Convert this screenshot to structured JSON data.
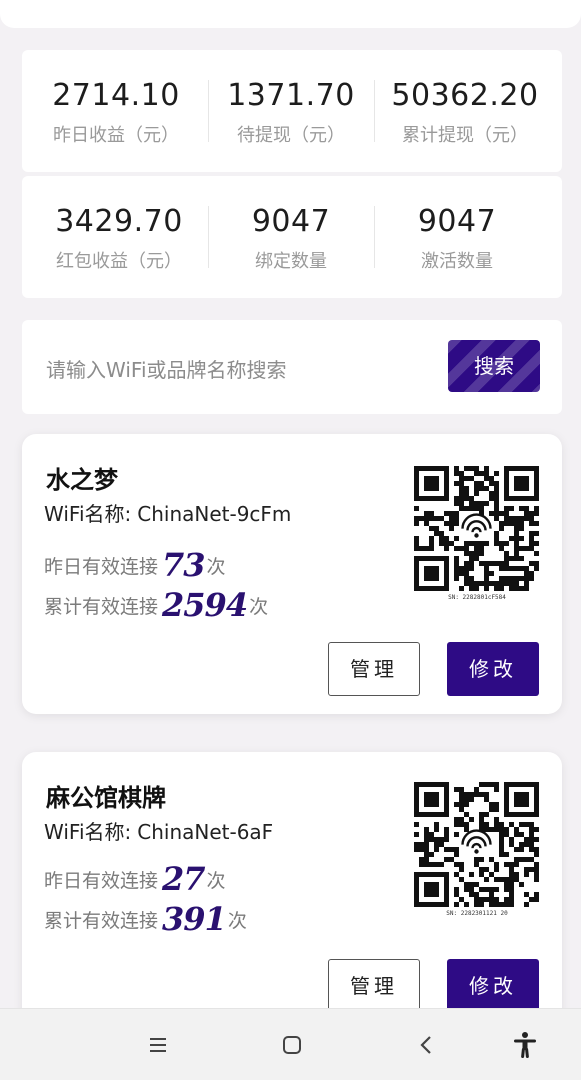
{
  "stats": {
    "yesterday_income": {
      "value": "2714.10",
      "label": "昨日收益（元）"
    },
    "pending_withdraw": {
      "value": "1371.70",
      "label": "待提现（元）"
    },
    "total_withdraw": {
      "value": "50362.20",
      "label": "累计提现（元）"
    },
    "redpacket_income": {
      "value": "3429.70",
      "label": "红包收益（元）"
    },
    "bound_count": {
      "value": "9047",
      "label": "绑定数量"
    },
    "activated_count": {
      "value": "9047",
      "label": "激活数量"
    }
  },
  "search": {
    "placeholder": "请输入WiFi或品牌名称搜索",
    "button_label": "搜索"
  },
  "stores": [
    {
      "name": "水之梦",
      "wifi_label": "WiFi名称:",
      "wifi_name": "ChinaNet-9cFm",
      "yesterday_label": "昨日有效连接",
      "yesterday_count": "73",
      "total_label": "累计有效连接",
      "total_count": "2594",
      "unit": "次",
      "qr_sn": "SN: 2282801cF584",
      "manage_label": "管理",
      "edit_label": "修改"
    },
    {
      "name": "麻公馆棋牌",
      "wifi_label": "WiFi名称:",
      "wifi_name": "ChinaNet-6aF",
      "yesterday_label": "昨日有效连接",
      "yesterday_count": "27",
      "total_label": "累计有效连接",
      "total_count": "391",
      "unit": "次",
      "qr_sn": "SN: 2282301121 20",
      "manage_label": "管理",
      "edit_label": "修改"
    }
  ],
  "navbar": {
    "icons": [
      "menu-icon",
      "home-square-icon",
      "back-chevron-icon",
      "accessibility-icon"
    ]
  },
  "colors": {
    "accent": "#2e0b85",
    "background": "#f3f1f4",
    "count_text": "#2a1170"
  }
}
